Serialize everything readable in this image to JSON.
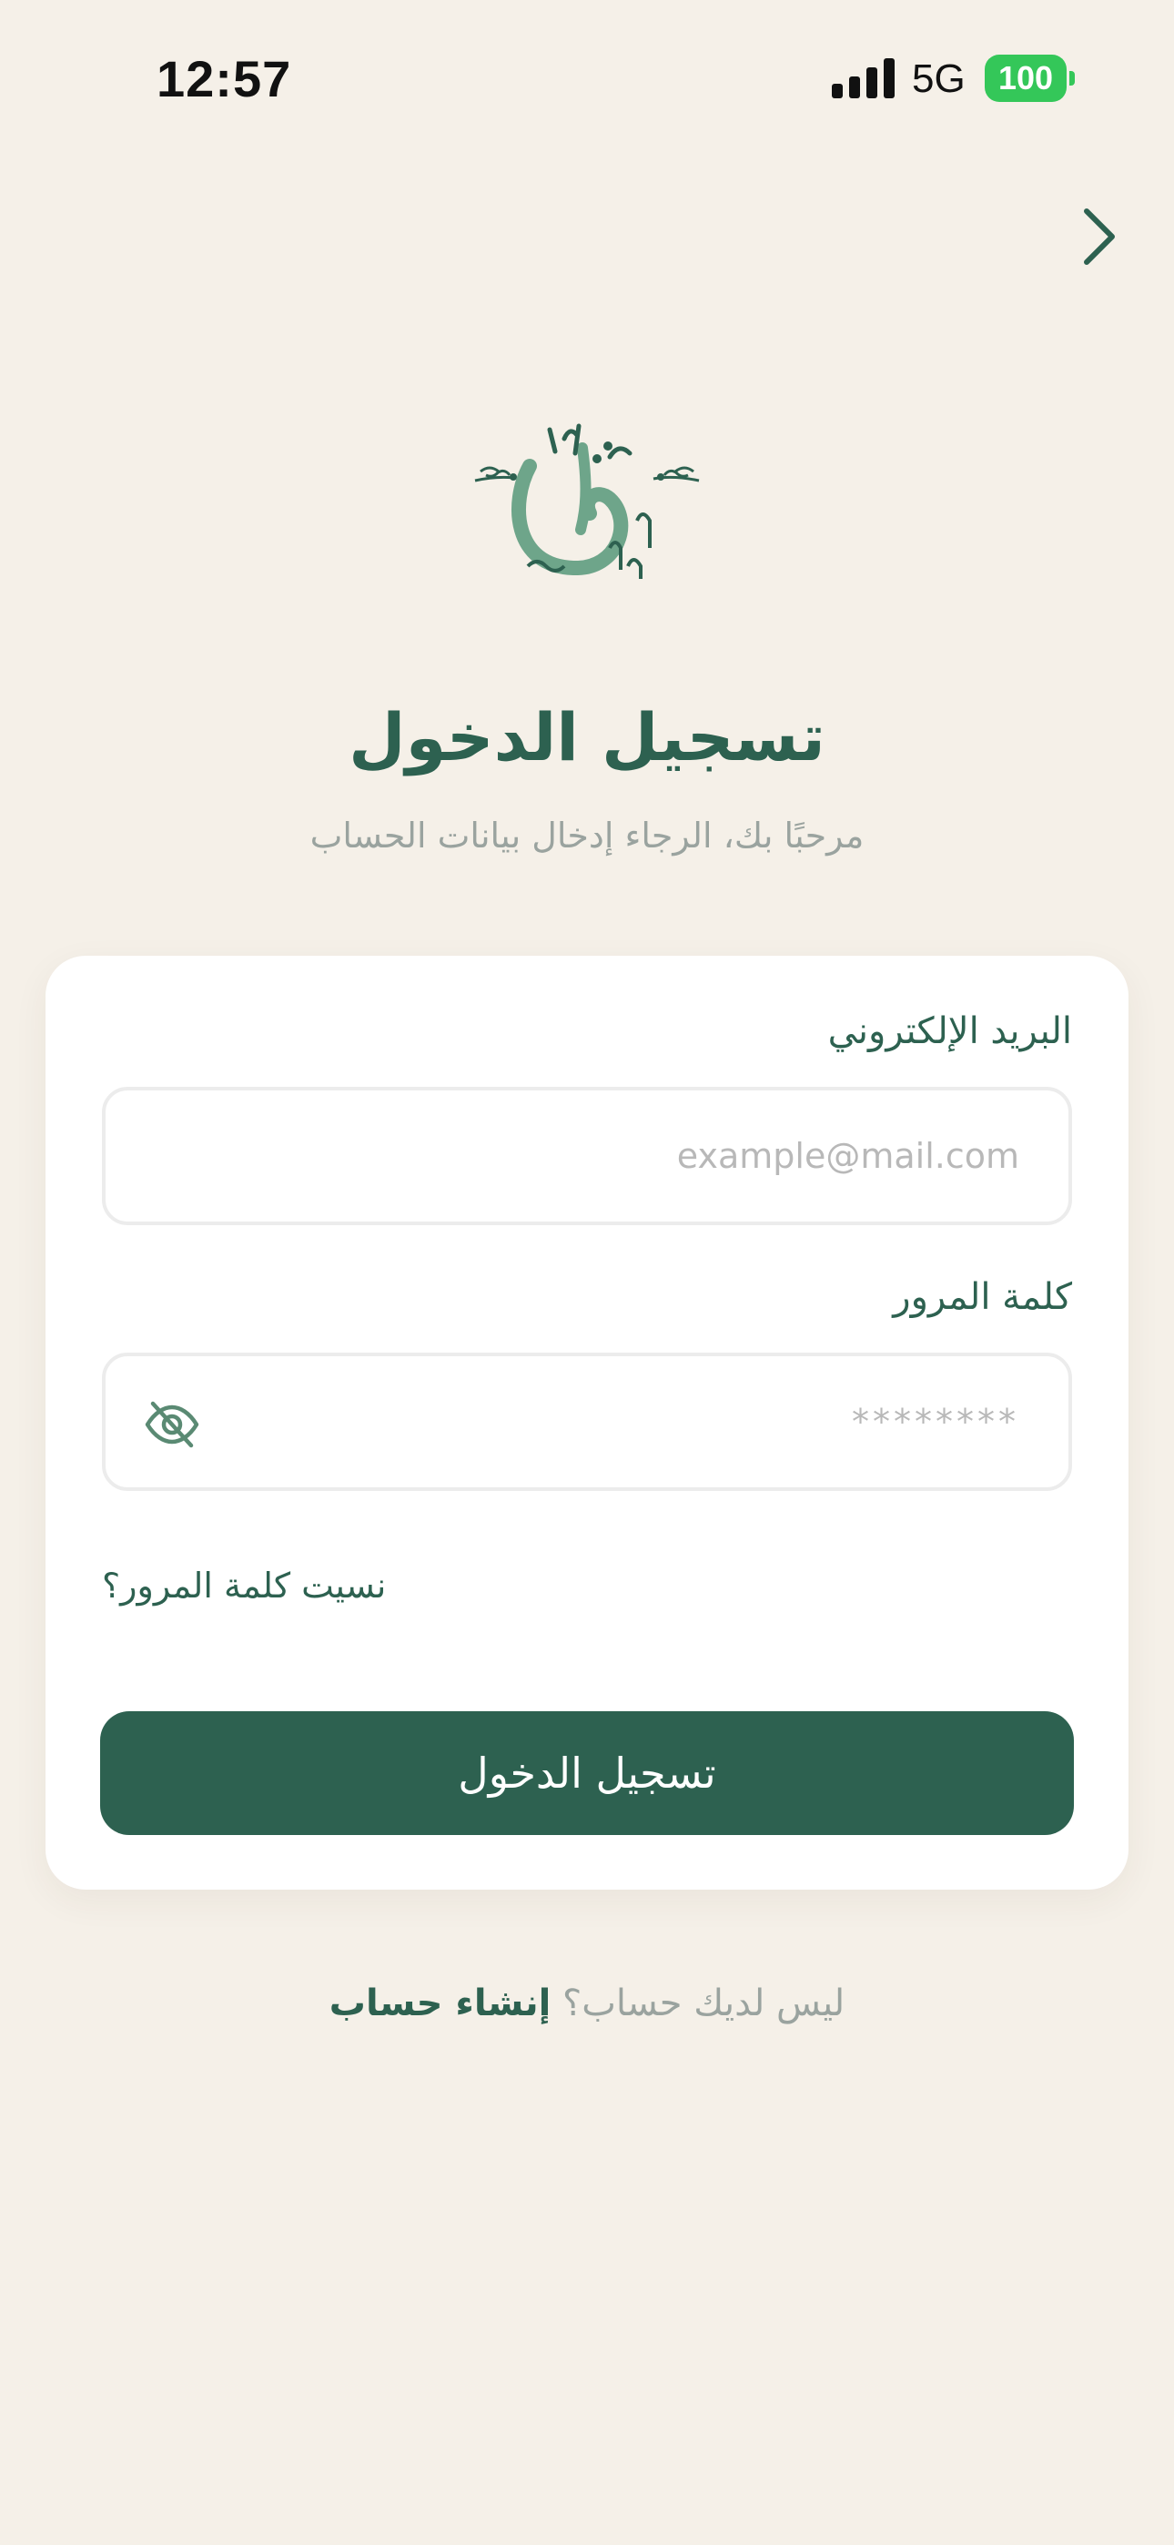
{
  "status_bar": {
    "time": "12:57",
    "network": "5G",
    "battery": "100",
    "battery_color": "#34c759"
  },
  "navigation": {
    "back_icon": "chevron-right-icon"
  },
  "logo": {
    "icon": "calligraphy-logo-icon",
    "text": "نَفَس"
  },
  "header": {
    "title": "تسجيل الدخول",
    "subtitle": "مرحبًا بك، الرجاء إدخال بيانات الحساب"
  },
  "form": {
    "email_label": "البريد الإلكتروني",
    "email_placeholder": "example@mail.com",
    "email_value": "",
    "password_label": "كلمة المرور",
    "password_placeholder": "********",
    "password_value": "",
    "visibility_icon": "eye-off-icon",
    "forgot_password": "نسيت كلمة المرور؟",
    "submit_label": "تسجيل الدخول"
  },
  "footer": {
    "question": "ليس لديك حساب؟",
    "signup_link": "إنشاء حساب"
  },
  "colors": {
    "primary": "#2d6150",
    "background": "#f5f0e8",
    "muted_text": "#9aa39f",
    "logo_light": "#6ea58a"
  }
}
